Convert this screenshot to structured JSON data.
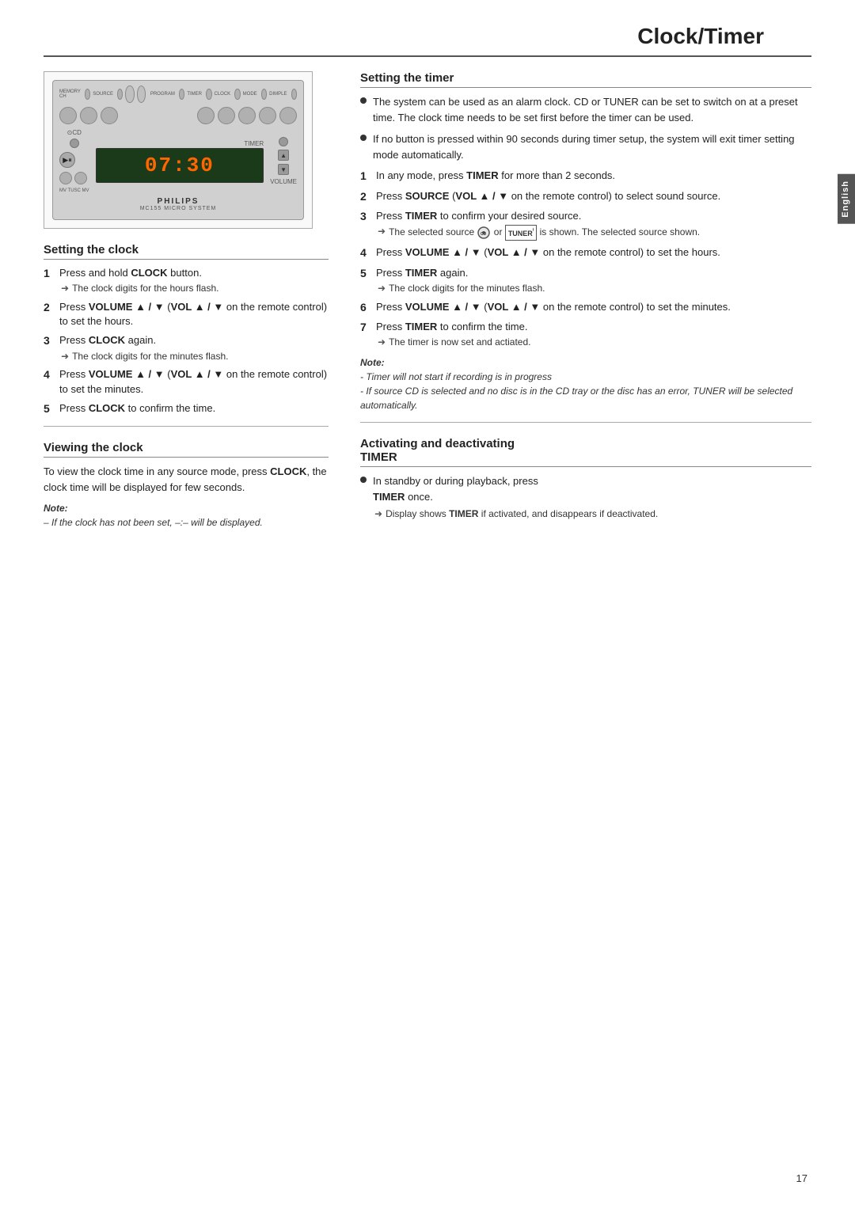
{
  "page": {
    "title": "Clock/Timer",
    "number": "17",
    "side_tab": "English"
  },
  "device": {
    "display_time": "07:30",
    "brand": "PHILIPS",
    "model": "MC155 MICRO SYSTEM",
    "timer_label": "TIMER"
  },
  "setting_clock": {
    "heading": "Setting the clock",
    "steps": [
      {
        "num": "1",
        "text": "Press and hold ",
        "bold": "CLOCK",
        "text2": " button.",
        "note": "The clock digits for the hours flash."
      },
      {
        "num": "2",
        "text": "Press ",
        "bold": "VOLUME ▲ / ▼",
        "text2": " (",
        "bold2": "VOL ▲ / ▼",
        "text3": " on the remote control) to set the hours.",
        "note": null
      },
      {
        "num": "3",
        "text": "Press ",
        "bold": "CLOCK",
        "text2": " again.",
        "note": "The clock digits for the minutes flash."
      },
      {
        "num": "4",
        "text": "Press ",
        "bold": "VOLUME ▲ / ▼",
        "text2": " (",
        "bold2": "VOL ▲ / ▼",
        "text3": " on the remote control) to set the minutes.",
        "note": null
      },
      {
        "num": "5",
        "text": "Press ",
        "bold": "CLOCK",
        "text2": " to confirm the time.",
        "note": null
      }
    ],
    "clock_note_label": "Note:",
    "clock_note_text": "– If the clock has not been set, –:– will be displayed."
  },
  "viewing_clock": {
    "heading": "Viewing the clock",
    "body": "To view the clock time in any source mode, press ",
    "bold": "CLOCK",
    "body2": ", the clock time will be displayed for few seconds."
  },
  "setting_timer": {
    "heading": "Setting the timer",
    "bullets": [
      "The system can be used as an alarm clock. CD or TUNER can be set to switch on at a preset time. The clock time needs to be set first before the timer can be used.",
      "If no button is pressed within 90 seconds during timer setup, the system will exit timer setting mode automatically."
    ],
    "steps": [
      {
        "num": "1",
        "text": "In any mode, press ",
        "bold": "TIMER",
        "text2": " for more than 2 seconds.",
        "note": null
      },
      {
        "num": "2",
        "text": "Press ",
        "bold": "SOURCE",
        "text2": " (",
        "bold2": "VOL ▲ / ▼",
        "text3": " on the remote control) to select sound source.",
        "note": null
      },
      {
        "num": "3",
        "text": "Press ",
        "bold": "TIMER",
        "text2": " to confirm your desired source.",
        "note": "The selected source  or  is shown. The selected source shown."
      },
      {
        "num": "4",
        "text": "Press ",
        "bold": "VOLUME ▲ / ▼",
        "text2": " (",
        "bold2": "VOL ▲ / ▼",
        "text3": " on the remote control) to set the hours.",
        "note": null
      },
      {
        "num": "5",
        "text": "Press ",
        "bold": "TIMER",
        "text2": " again.",
        "note": "The clock digits for the minutes flash."
      },
      {
        "num": "6",
        "text": "Press ",
        "bold": "VOLUME ▲ / ▼",
        "text2": " (",
        "bold2": "VOL ▲ / ▼",
        "text3": " on the remote control) to set the minutes.",
        "note": null
      },
      {
        "num": "7",
        "text": "Press ",
        "bold": "TIMER",
        "text2": " to confirm the time.",
        "note": "The timer is now set and actiated."
      }
    ],
    "timer_note_label": "Note:",
    "timer_note_line1": "- Timer will not start if recording is in progress",
    "timer_note_line2": "- If source CD is selected and no disc is in the CD tray or the disc has an error, TUNER will be selected automatically."
  },
  "activating": {
    "heading_line1": "Activating and deactivating",
    "heading_line2": "TIMER",
    "bullet": "In standby or during playback, press",
    "bold_timer": "TIMER",
    "bullet_end": " once.",
    "note": "Display shows ",
    "bold_note": "TIMER",
    "note_end": " if activated, and disappears if deactivated."
  }
}
